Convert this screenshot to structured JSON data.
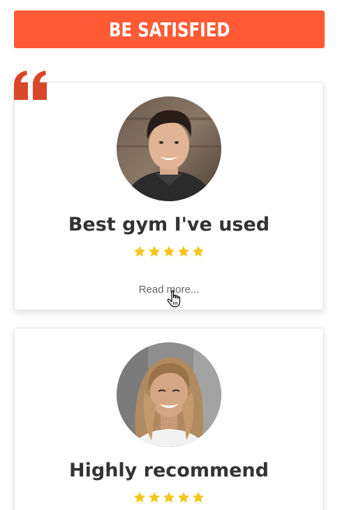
{
  "banner": {
    "title": "BE SATISFIED"
  },
  "colors": {
    "accent": "#ff5a36",
    "quote": "#d9472b",
    "star": "#f5c518",
    "title_text": "#333333",
    "link_text": "#666666"
  },
  "testimonials": [
    {
      "title": "Best gym I've used",
      "rating": 5,
      "read_more": "Read more..."
    },
    {
      "title": "Highly recommend",
      "rating": 5
    }
  ],
  "icons": [
    "quote-icon",
    "star-icon",
    "hand-pointer-icon"
  ]
}
